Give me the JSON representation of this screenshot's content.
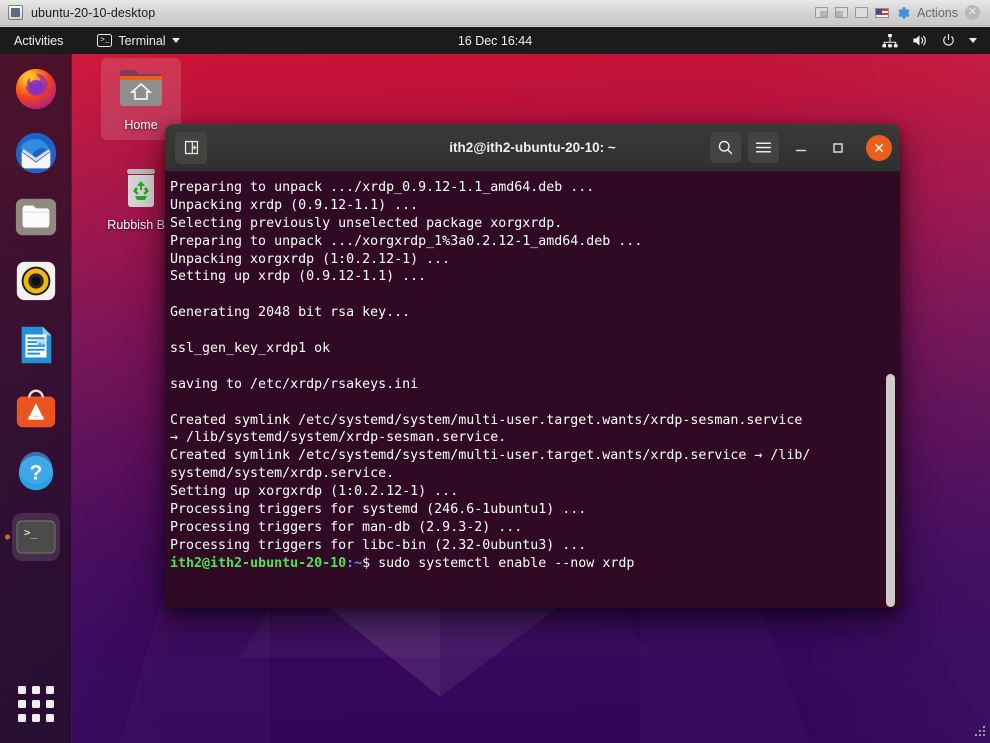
{
  "vbox_window": {
    "title": "ubuntu-20-10-desktop",
    "icon": "vm-screen-icon",
    "state_icons": [
      "window-state-icon",
      "window-state-icon",
      "window-state-icon"
    ],
    "keyboard_flag": "us-flag-icon",
    "settings_icon": "gear-icon",
    "actions_label": "Actions",
    "close_label": "✕"
  },
  "topbar": {
    "activities_label": "Activities",
    "app_menu": {
      "label": "Terminal",
      "icon": "terminal-icon",
      "caret": "chevron-down-icon"
    },
    "clock": "16 Dec  16:44",
    "tray": [
      {
        "name": "network-wired-icon"
      },
      {
        "name": "volume-icon"
      },
      {
        "name": "power-icon"
      },
      {
        "name": "chevron-down-icon"
      }
    ]
  },
  "dock": {
    "items": [
      {
        "name": "firefox",
        "label": "Firefox Web Browser",
        "active": false
      },
      {
        "name": "thunderbird",
        "label": "Thunderbird Mail",
        "active": false
      },
      {
        "name": "files",
        "label": "Files",
        "active": false
      },
      {
        "name": "rhythmbox",
        "label": "Rhythmbox",
        "active": false
      },
      {
        "name": "libreoffice-writer",
        "label": "LibreOffice Writer",
        "active": false
      },
      {
        "name": "ubuntu-software",
        "label": "Ubuntu Software",
        "active": false
      },
      {
        "name": "help",
        "label": "Help",
        "active": false
      },
      {
        "name": "terminal",
        "label": "Terminal",
        "active": true
      }
    ],
    "show_applications_label": "Show Applications"
  },
  "desktop_icons": [
    {
      "name": "home",
      "label": "Home",
      "selected": true
    },
    {
      "name": "rubbish-bin",
      "label": "Rubbish Bin",
      "selected": false
    }
  ],
  "terminal": {
    "title": "ith2@ith2-ubuntu-20-10: ~",
    "new_tab_label": "New Tab",
    "search_label": "Search",
    "menu_label": "Menu",
    "minimize_label": "–",
    "maximize_label": "□",
    "close_label": "✕",
    "background_color": "#300a24",
    "prompt": {
      "user_host": "ith2@ith2-ubuntu-20-10",
      "path": ":~",
      "sigil": "$",
      "command": " sudo systemctl enable --now xrdp"
    },
    "lines": [
      "Preparing to unpack .../xrdp_0.9.12-1.1_amd64.deb ...",
      "Unpacking xrdp (0.9.12-1.1) ...",
      "Selecting previously unselected package xorgxrdp.",
      "Preparing to unpack .../xorgxrdp_1%3a0.2.12-1_amd64.deb ...",
      "Unpacking xorgxrdp (1:0.2.12-1) ...",
      "Setting up xrdp (0.9.12-1.1) ...",
      "",
      "Generating 2048 bit rsa key...",
      "",
      "ssl_gen_key_xrdp1 ok",
      "",
      "saving to /etc/xrdp/rsakeys.ini",
      "",
      "Created symlink /etc/systemd/system/multi-user.target.wants/xrdp-sesman.service",
      "→ /lib/systemd/system/xrdp-sesman.service.",
      "Created symlink /etc/systemd/system/multi-user.target.wants/xrdp.service → /lib/",
      "systemd/system/xrdp.service.",
      "Setting up xorgxrdp (1:0.2.12-1) ...",
      "Processing triggers for systemd (246.6-1ubuntu1) ...",
      "Processing triggers for man-db (2.9.3-2) ...",
      "Processing triggers for libc-bin (2.32-0ubuntu3) ..."
    ]
  }
}
